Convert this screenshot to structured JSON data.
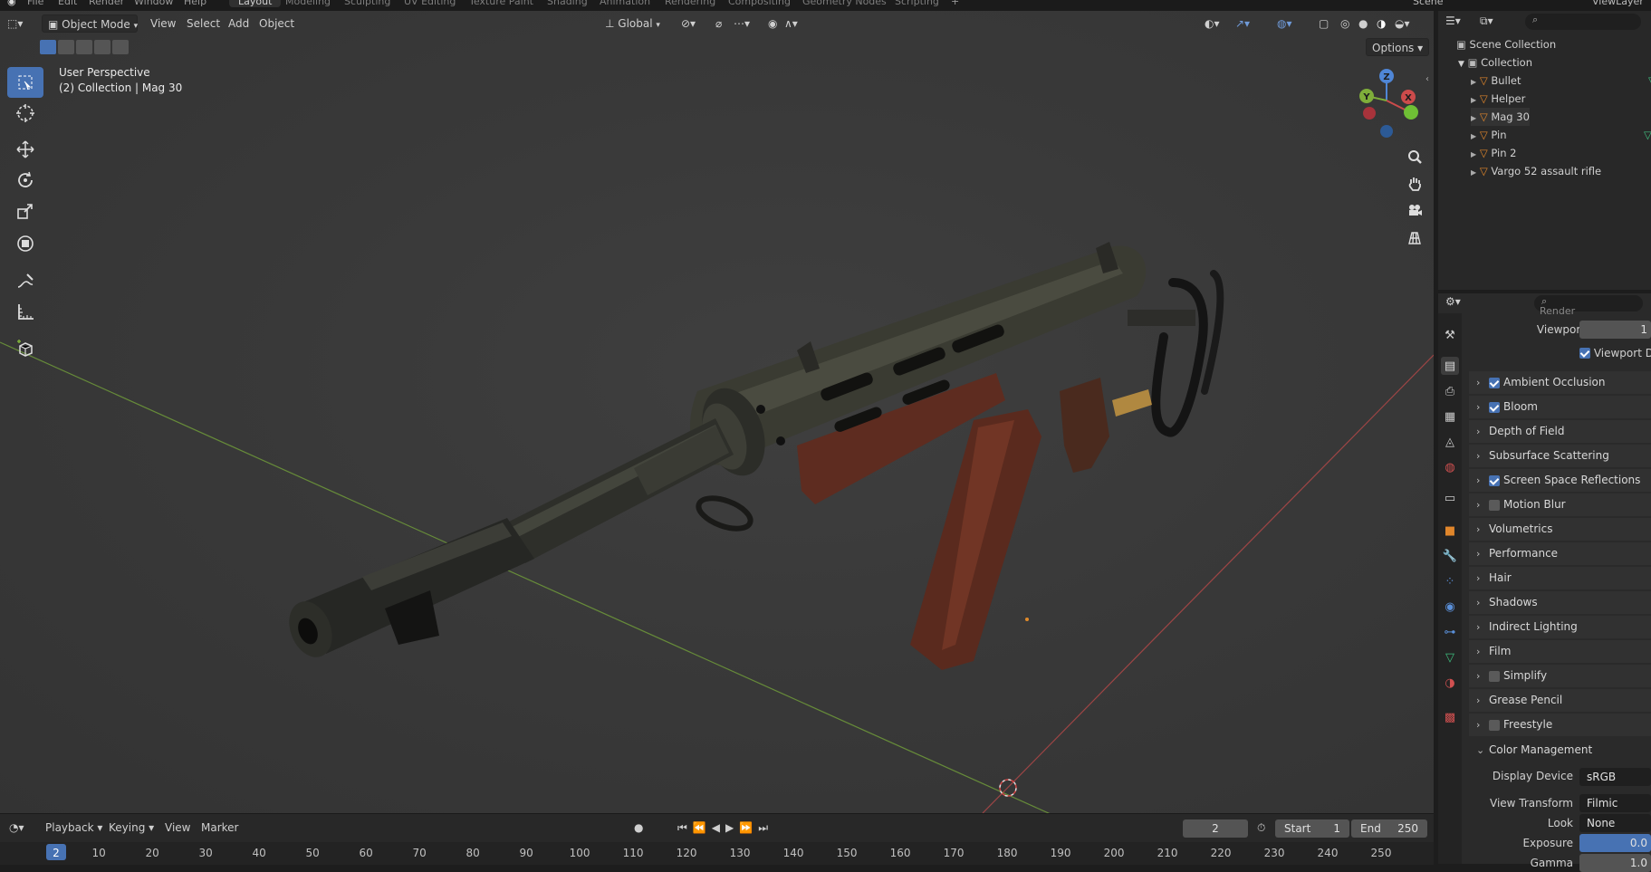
{
  "top_menu": {
    "items": [
      "File",
      "Edit",
      "Render",
      "Window",
      "Help"
    ]
  },
  "workspaces": {
    "tabs": [
      "Layout",
      "Modeling",
      "Sculpting",
      "UV Editing",
      "Texture Paint",
      "Shading",
      "Animation",
      "Rendering",
      "Compositing",
      "Geometry Nodes",
      "Scripting"
    ],
    "active": "Layout",
    "add": "+",
    "scene": "Scene",
    "view_layer": "ViewLayer"
  },
  "viewport": {
    "mode": "Object Mode",
    "menus": [
      "View",
      "Select",
      "Add",
      "Object"
    ],
    "orientation": "Global",
    "options": "Options",
    "info_line1": "User Perspective",
    "info_line2": "(2) Collection | Mag 30",
    "gizmo": {
      "x": "X",
      "y": "Y",
      "z": "Z"
    }
  },
  "timeline": {
    "playback": "Playback",
    "keying": "Keying",
    "view": "View",
    "marker": "Marker",
    "current_frame": "2",
    "start_label": "Start",
    "start": "1",
    "end_label": "End",
    "end": "250",
    "ticks": [
      "2",
      "10",
      "20",
      "30",
      "40",
      "50",
      "60",
      "70",
      "80",
      "90",
      "100",
      "110",
      "120",
      "130",
      "140",
      "150",
      "160",
      "170",
      "180",
      "190",
      "200",
      "210",
      "220",
      "230",
      "240",
      "250"
    ]
  },
  "outliner": {
    "root": "Scene Collection",
    "collection": "Collection",
    "objects": [
      "Bullet",
      "Helper",
      "Mag 30",
      "Pin",
      "Pin 2",
      "Vargo 52 assault rifle"
    ]
  },
  "properties": {
    "partial_top": "Render",
    "viewport_label": "Viewport",
    "viewport_value": "1",
    "viewport_denoise": "Viewport De",
    "panels": [
      {
        "label": "Ambient Occlusion",
        "checkbox": true,
        "checked": true
      },
      {
        "label": "Bloom",
        "checkbox": true,
        "checked": true
      },
      {
        "label": "Depth of Field",
        "checkbox": false
      },
      {
        "label": "Subsurface Scattering",
        "checkbox": false
      },
      {
        "label": "Screen Space Reflections",
        "checkbox": true,
        "checked": true
      },
      {
        "label": "Motion Blur",
        "checkbox": true,
        "checked": false
      },
      {
        "label": "Volumetrics",
        "checkbox": false
      },
      {
        "label": "Performance",
        "checkbox": false
      },
      {
        "label": "Hair",
        "checkbox": false
      },
      {
        "label": "Shadows",
        "checkbox": false
      },
      {
        "label": "Indirect Lighting",
        "checkbox": false
      },
      {
        "label": "Film",
        "checkbox": false
      },
      {
        "label": "Simplify",
        "checkbox": true,
        "checked": false
      },
      {
        "label": "Grease Pencil",
        "checkbox": false
      },
      {
        "label": "Freestyle",
        "checkbox": true,
        "checked": false
      }
    ],
    "color_management": {
      "label": "Color Management",
      "display_device_label": "Display Device",
      "display_device": "sRGB",
      "view_transform_label": "View Transform",
      "view_transform": "Filmic",
      "look_label": "Look",
      "look": "None",
      "exposure_label": "Exposure",
      "exposure": "0.0",
      "gamma_label": "Gamma",
      "gamma": "1.0"
    }
  },
  "colors": {
    "accent": "#4772b3",
    "x_axis": "#cc4b4b",
    "y_axis": "#7fae3a",
    "z_axis": "#4f86d6",
    "mesh_icon": "#e0862b",
    "vertex_icon": "#3fbf7f"
  }
}
